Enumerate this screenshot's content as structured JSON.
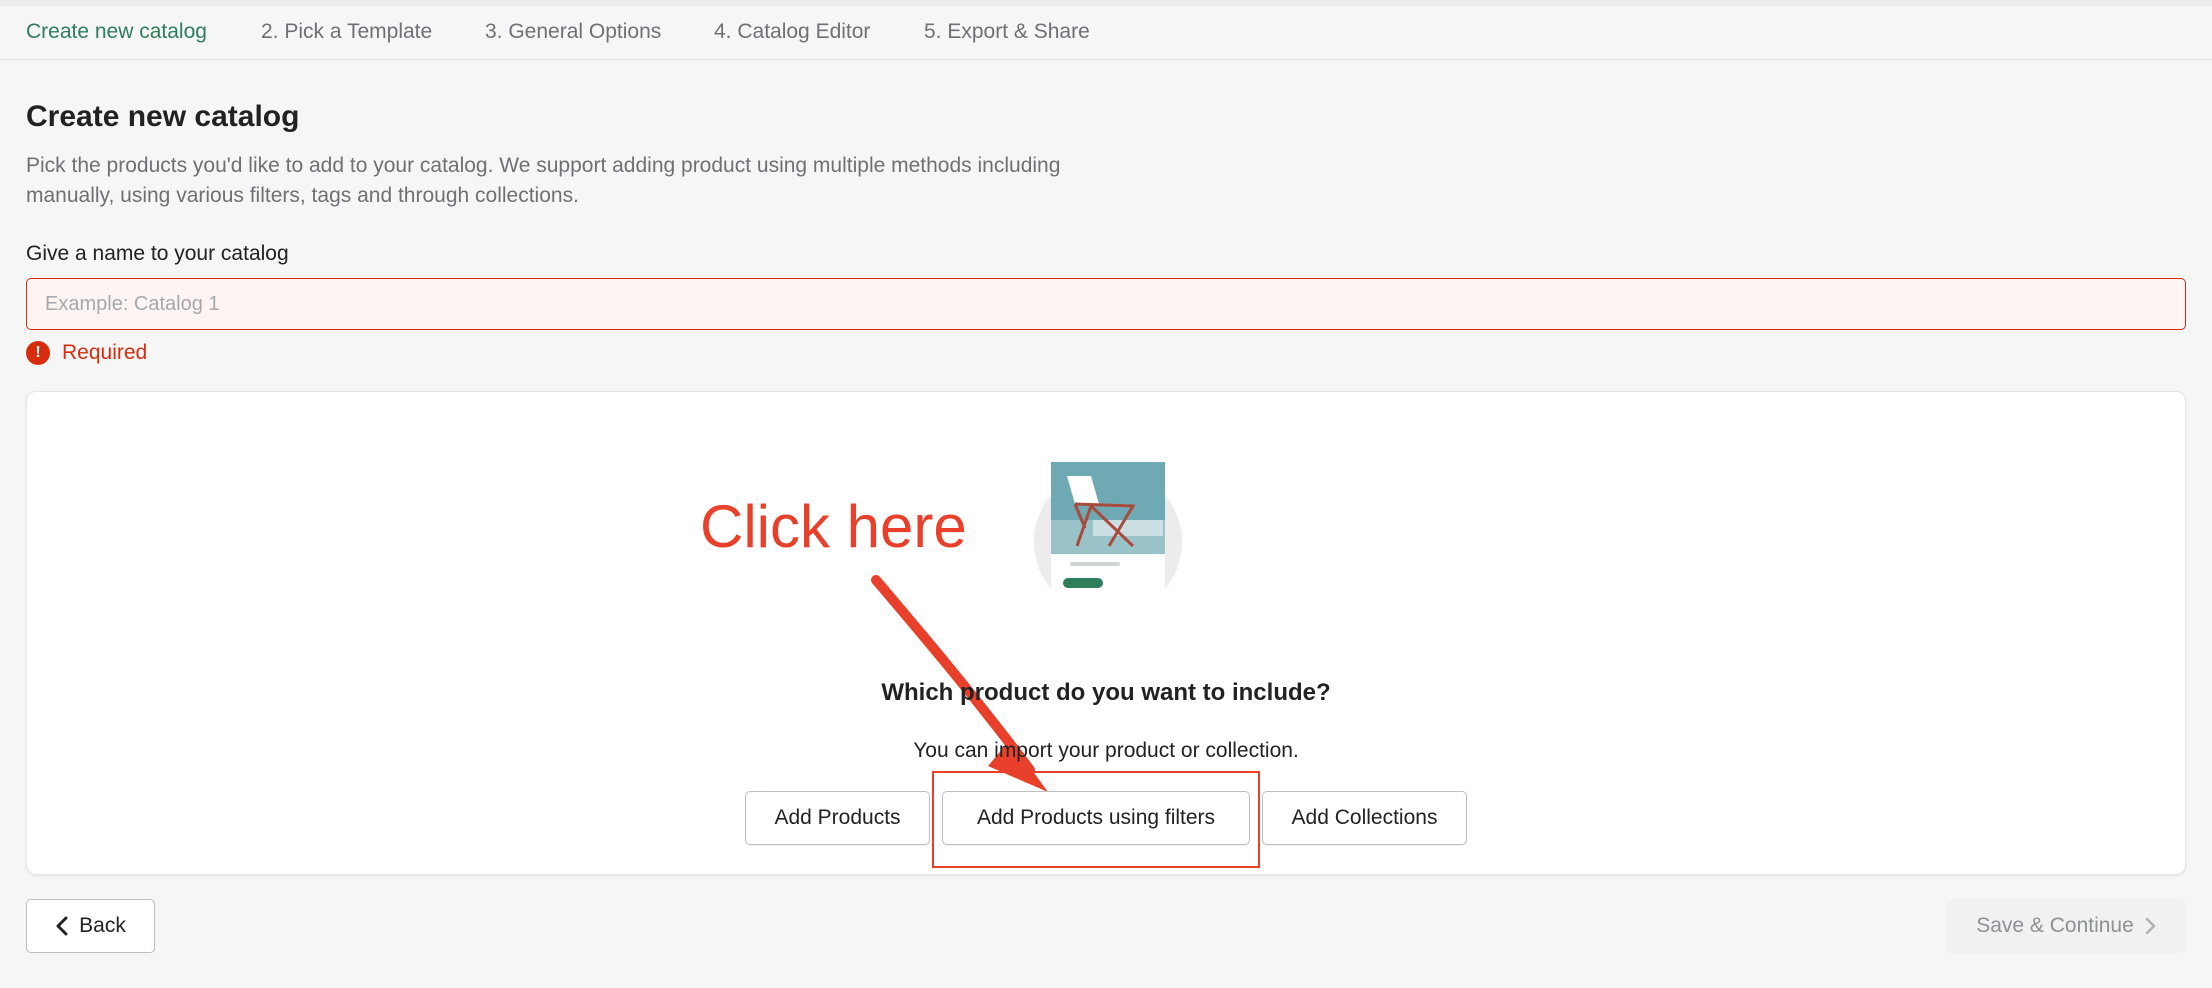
{
  "stepper": {
    "steps": [
      {
        "label": "Create new catalog",
        "active": true
      },
      {
        "label": "2. Pick a Template",
        "active": false
      },
      {
        "label": "3. General Options",
        "active": false
      },
      {
        "label": "4. Catalog Editor",
        "active": false
      },
      {
        "label": "5. Export & Share",
        "active": false
      }
    ]
  },
  "header": {
    "title": "Create new catalog",
    "description": "Pick the products you'd like to add to your catalog. We support adding product using multiple methods including manually, using various filters, tags and through collections."
  },
  "name_field": {
    "label": "Give a name to your catalog",
    "value": "",
    "placeholder": "Example: Catalog 1",
    "error_icon": "!",
    "error": "Required"
  },
  "empty_state": {
    "illustration_icon": "catalog-illustration-icon",
    "title": "Which product do you want to include?",
    "subtitle": "You can import your product or collection.",
    "buttons": {
      "add_products": "Add Products",
      "add_products_filters": "Add Products using filters",
      "add_collections": "Add Collections"
    }
  },
  "annotation": {
    "text": "Click here",
    "color": "#e8402a"
  },
  "footer": {
    "back_icon": "chevron-left-icon",
    "back_label": "Back",
    "save_label": "Save & Continue",
    "save_icon": "chevron-right-icon"
  },
  "colors": {
    "accent": "#2e7d5b",
    "error": "#d72c0d",
    "annotation": "#e8402a"
  }
}
